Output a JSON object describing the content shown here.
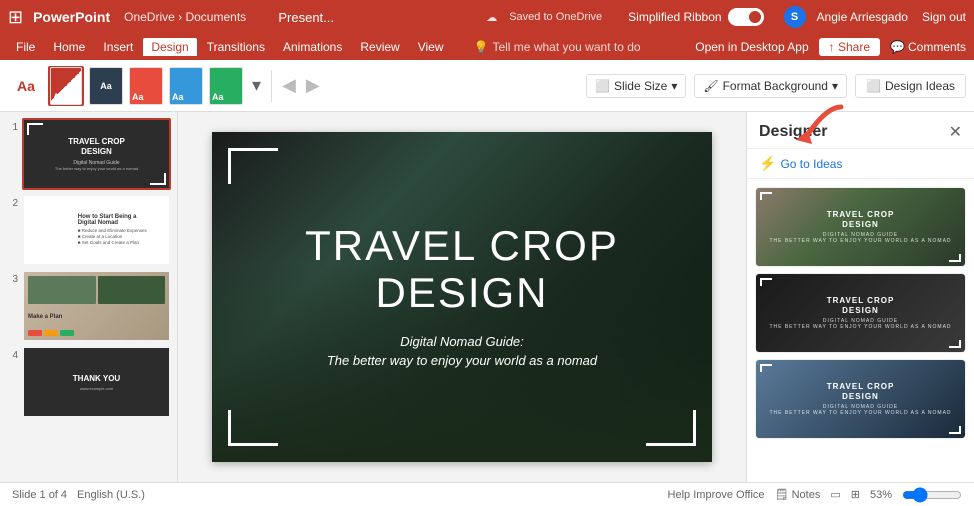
{
  "titlebar": {
    "app_name": "PowerPoint",
    "breadcrumb": "OneDrive › Documents",
    "file_name": "Present...",
    "save_status": "Saved to OneDrive",
    "simplified_ribbon_label": "Simplified Ribbon",
    "user_initial": "S",
    "user_name": "Angie Arriesgado",
    "sign_out": "Sign out"
  },
  "menubar": {
    "items": [
      "File",
      "Home",
      "Insert",
      "Design",
      "Transitions",
      "Animations",
      "Review",
      "View"
    ],
    "active_item": "Design",
    "search_placeholder": "Tell me what you want to do",
    "open_desktop": "Open in Desktop App",
    "share": "Share",
    "comments": "Comments"
  },
  "ribbon": {
    "slide_size_label": "Slide Size",
    "format_background_label": "Format Background",
    "design_ideas_label": "Design Ideas",
    "more_label": "▾"
  },
  "slides": [
    {
      "num": "1",
      "title": "TRAVEL CROP DESIGN",
      "subtitle": "Digital Nomad Guide",
      "type": "dark"
    },
    {
      "num": "2",
      "title": "How to Start Being a Digital Nomad",
      "type": "light"
    },
    {
      "num": "3",
      "title": "Make a Plan",
      "type": "light-image"
    },
    {
      "num": "4",
      "title": "THANK YOU",
      "type": "dark"
    }
  ],
  "main_slide": {
    "title_line1": "TRAVEL CROP",
    "title_line2": "DESIGN",
    "subtitle_line1": "Digital Nomad Guide:",
    "subtitle_line2": "The better way to enjoy your world as a nomad"
  },
  "designer": {
    "title": "Designer",
    "go_to_ideas": "Go to Ideas",
    "suggestions": [
      {
        "title": "TRAVEL CROP",
        "title2": "DESIGN",
        "sub": "Digital Nomad Guide",
        "sub2": "The better way to enjoy your world as a nomad"
      },
      {
        "title": "TRAVEL CROP",
        "title2": "DESIGN",
        "sub": "Digital Nomad Guide",
        "sub2": "The better way to enjoy your world as a nomad"
      },
      {
        "title": "TRAVEL CROP",
        "title2": "DESIGN",
        "sub": "Digital Nomad Guide",
        "sub2": "The better way to enjoy your world as a nomad"
      }
    ]
  },
  "statusbar": {
    "slide_info": "Slide 1 of 4",
    "language": "English (U.S.)",
    "help": "Help Improve Office",
    "notes": "Notes",
    "zoom": "53%"
  }
}
